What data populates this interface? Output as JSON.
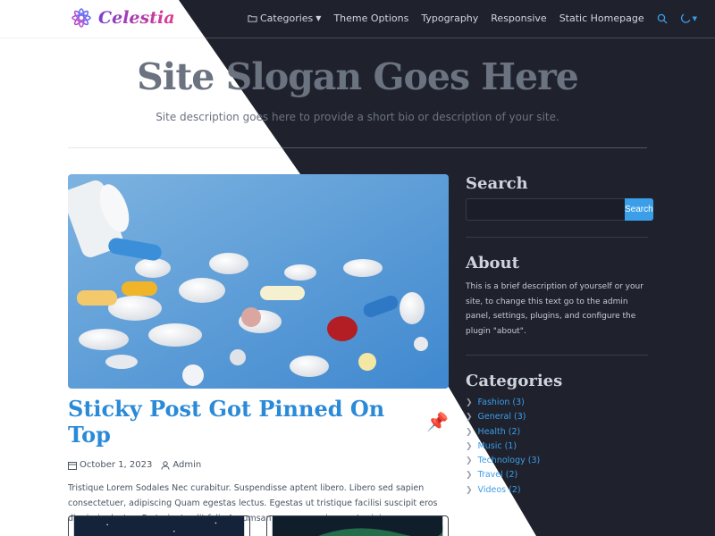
{
  "header": {
    "logo_text": "Celestia",
    "nav": [
      {
        "label": "Categories",
        "has_dropdown": true,
        "icon": "folder-icon"
      },
      {
        "label": "Theme Options"
      },
      {
        "label": "Typography"
      },
      {
        "label": "Responsive"
      },
      {
        "label": "Static Homepage"
      }
    ],
    "search_icon": "search-icon",
    "theme_icon": "moon-icon"
  },
  "hero": {
    "slogan": "Site Slogan Goes Here",
    "description": "Site description goes here to provide a short bio or description of your site."
  },
  "post": {
    "title": "Sticky Post Got Pinned On Top",
    "pin_icon": "pin-icon",
    "date": "October 1, 2023",
    "author": "Admin",
    "excerpt": "Tristique Lorem Sodales Nec curabitur. Suspendisse aptent libero. Libero sed sapien consectetuer, adipiscing Quam egestas lectus. Egestas ut tristique facilisi suscipit eros dignissim luctus. Parturient velit felis Accumsan arcu massa ipsum. Lacinia ..."
  },
  "sidebar": {
    "search_title": "Search",
    "search_button": "Search",
    "search_placeholder": "",
    "about_title": "About",
    "about_text": "This is a brief description of yourself or your site, to change this text go to the admin panel, settings, plugins, and configure the plugin \"about\".",
    "categories_title": "Categories",
    "categories": [
      "Fashion (3)",
      "General (3)",
      "Health (2)",
      "Music (1)",
      "Technology (3)",
      "Travel (2)",
      "Videos (2)"
    ]
  },
  "colors": {
    "accent": "#3b9ee8",
    "dark_bg": "#1f222d",
    "pin": "#e11d48"
  }
}
